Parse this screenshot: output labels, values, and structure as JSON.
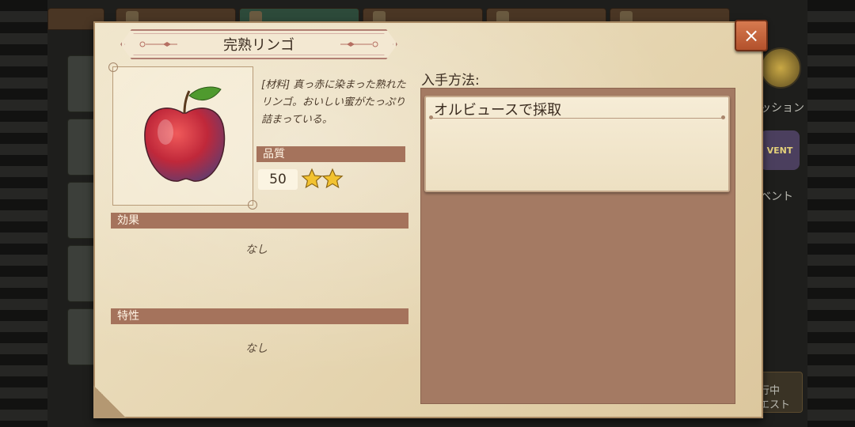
{
  "background": {
    "right_panel": {
      "mission_text": "ッション",
      "event_badge": "VENT",
      "event_text": "ベント",
      "quest_line1": "行中",
      "quest_line2": "エスト"
    }
  },
  "dialog": {
    "title": "完熟リンゴ",
    "close_label": "×",
    "description": "[材料] 真っ赤に染まった熟れたリンゴ。おいしい蜜がたっぷり詰まっている。",
    "quality": {
      "label": "品質",
      "value": "50",
      "stars": 2
    },
    "effect": {
      "label": "効果",
      "value": "なし"
    },
    "trait": {
      "label": "特性",
      "value": "なし"
    },
    "acquisition": {
      "label": "入手方法:",
      "methods": [
        "オルビュースで採取"
      ]
    }
  },
  "colors": {
    "section_bar": "#a5735c",
    "close_button": "#c5653c",
    "star": "#f2c230",
    "apple": "#c0283a"
  },
  "icons": {
    "close": "close-icon",
    "star": "star-icon",
    "item": "red-apple-icon"
  }
}
